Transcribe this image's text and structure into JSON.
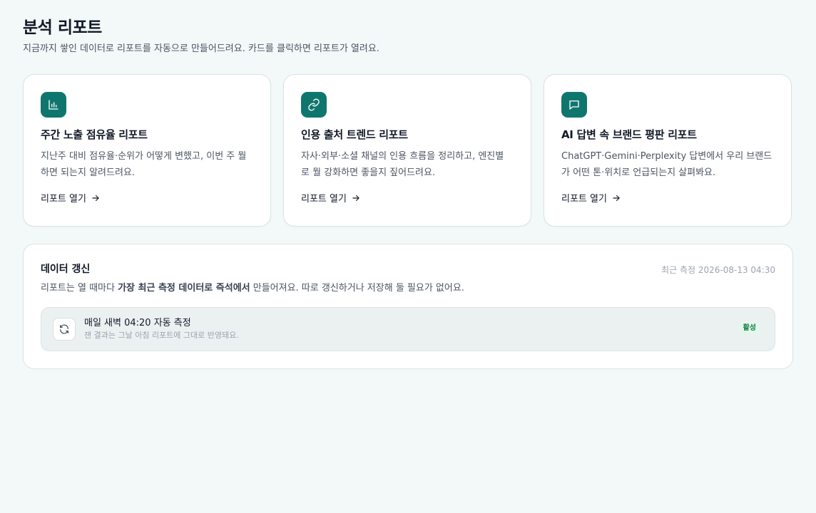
{
  "header": {
    "title": "분석 리포트",
    "subtitle": "지금까지 쌓인 데이터로 리포트를 자동으로 만들어드려요. 카드를 클릭하면 리포트가 열려요."
  },
  "cards": [
    {
      "icon": "bar-chart-icon",
      "title": "주간 노출 점유율 리포트",
      "description": "지난주 대비 점유율·순위가 어떻게 변했고, 이번 주 뭘 하면 되는지 알려드려요.",
      "link_label": "리포트 열기"
    },
    {
      "icon": "link-icon",
      "title": "인용 출처 트렌드 리포트",
      "description": "자사·외부·소셜 채널의 인용 흐름을 정리하고, 엔진별로 뭘 강화하면 좋을지 짚어드려요.",
      "link_label": "리포트 열기"
    },
    {
      "icon": "message-icon",
      "title": "AI 답변 속 브랜드 평판 리포트",
      "description": "ChatGPT·Gemini·Perplexity 답변에서 우리 브랜드가 어떤 톤·위치로 언급되는지 살펴봐요.",
      "link_label": "리포트 열기"
    }
  ],
  "refresh": {
    "title": "데이터 갱신",
    "last_measured": "최근 측정 2026-08-13 04:30",
    "desc_before": "리포트는 열 때마다 ",
    "desc_bold": "가장 최근 측정 데이터로 즉석에서",
    "desc_after": " 만들어져요. 따로 갱신하거나 저장해 둘 필요가 없어요.",
    "schedule": {
      "icon": "refresh-icon",
      "title": "매일 새벽 04:20 자동 측정",
      "subtitle": "잰 결과는 그날 아침 리포트에 그대로 반영돼요.",
      "badge": "활성",
      "badge_color": "#15803d"
    }
  },
  "colors": {
    "accent": "#0f766e",
    "background": "#f3f8f8"
  }
}
